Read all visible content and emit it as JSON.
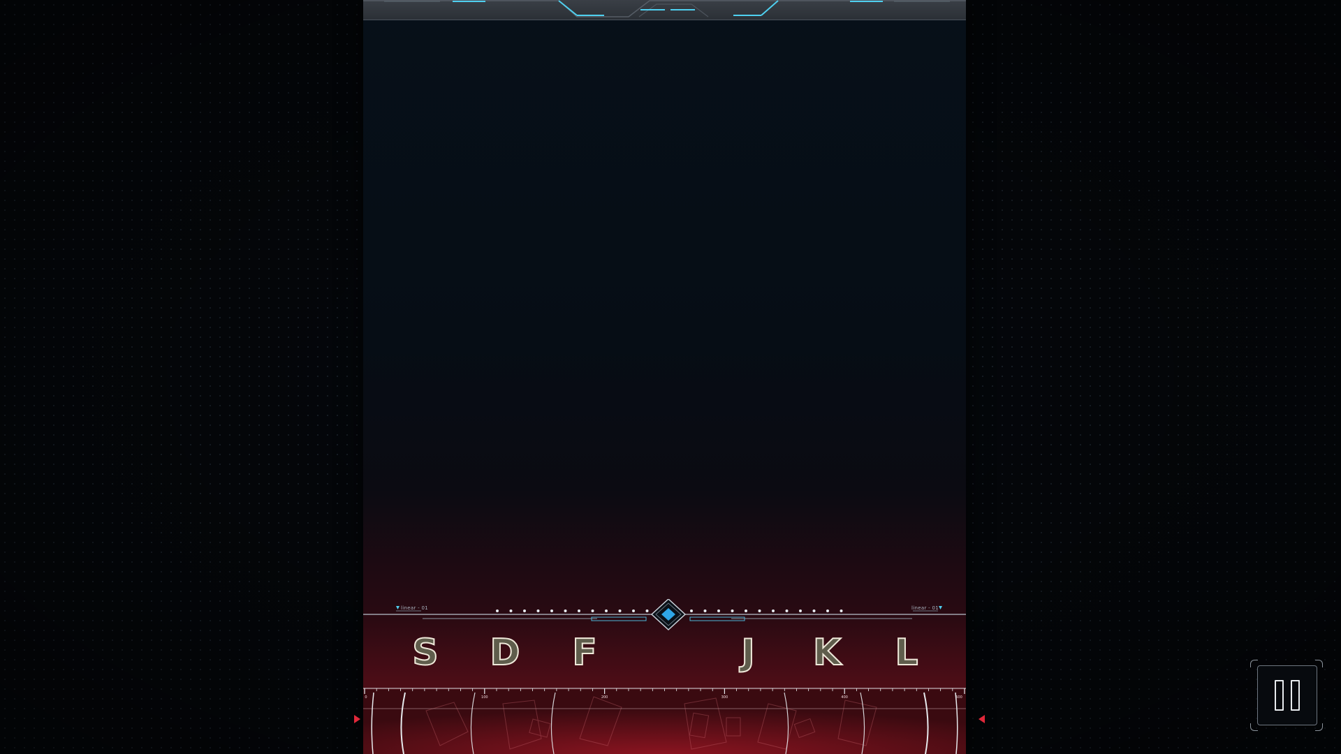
{
  "judge_line": {
    "left_label": "linear - 01",
    "right_label": "linear - 01"
  },
  "keys": [
    "S",
    "D",
    "F",
    "J",
    "K",
    "L"
  ],
  "ruler": {
    "tick_labels": [
      "0",
      "100",
      "200",
      "300",
      "400",
      "500"
    ]
  },
  "pause_button": {
    "icon": "pause-icon"
  },
  "colors": {
    "accent_cyan": "#4fd0f0",
    "accent_red": "#e0283a",
    "key_outline": "#efe9da",
    "lane_bottom": "#5a0f18"
  }
}
